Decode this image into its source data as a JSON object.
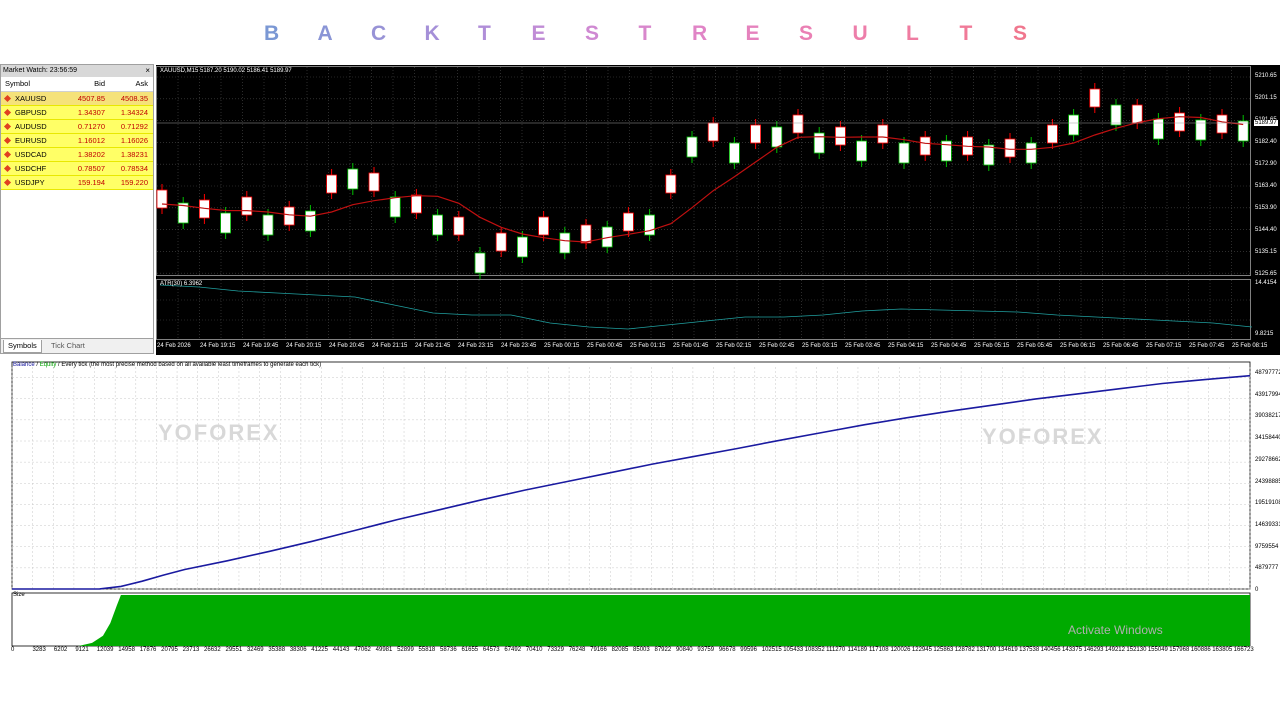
{
  "header": {
    "letters": [
      "B",
      "A",
      "C",
      "K",
      "T",
      "E",
      "S",
      "T",
      "R",
      "E",
      "S",
      "U",
      "L",
      "T",
      "S"
    ],
    "letter_colors": [
      "#7b98d4",
      "#8a95d6",
      "#9893d6",
      "#a590d8",
      "#b08ed8",
      "#c08cd6",
      "#cf89d2",
      "#d887cc",
      "#e084c6",
      "#e582bd",
      "#ea80b4",
      "#ed7eaa",
      "#ef7ca1",
      "#f07a98",
      "#f0778e"
    ]
  },
  "market_watch": {
    "title": "Market Watch: 23:56:59",
    "close": "×",
    "col_symbol": "Symbol",
    "col_bid": "Bid",
    "col_ask": "Ask",
    "rows": [
      {
        "symbol": "XAUUSD",
        "bid": "4507.85",
        "ask": "4508.35"
      },
      {
        "symbol": "GBPUSD",
        "bid": "1.34307",
        "ask": "1.34324"
      },
      {
        "symbol": "AUDUSD",
        "bid": "0.71270",
        "ask": "0.71292"
      },
      {
        "symbol": "EURUSD",
        "bid": "1.16012",
        "ask": "1.16026"
      },
      {
        "symbol": "USDCAD",
        "bid": "1.38202",
        "ask": "1.38231"
      },
      {
        "symbol": "USDCHF",
        "bid": "0.78507",
        "ask": "0.78534"
      },
      {
        "symbol": "USDJPY",
        "bid": "159.194",
        "ask": "159.220"
      }
    ],
    "tab_symbols": "Symbols",
    "tab_tick": "Tick Chart"
  },
  "price_chart": {
    "info": "XAUUSD,M15  5187.20 5190.02 5186.41 5189.97",
    "price_labels": [
      "5210.65",
      "5201.15",
      "5191.65",
      "5182.40",
      "5172.90",
      "5163.40",
      "5153.90",
      "5144.40",
      "5135.15",
      "5125.65"
    ],
    "current_price": "5189.97",
    "atr_label": "ATR(30) 6.3962",
    "atr_labels": [
      "14.4154",
      "9.8215"
    ],
    "time_labels": [
      "24 Feb 2026",
      "24 Feb 19:15",
      "24 Feb 19:45",
      "24 Feb 20:15",
      "24 Feb 20:45",
      "24 Feb 21:15",
      "24 Feb 21:45",
      "24 Feb 23:15",
      "24 Feb 23:45",
      "25 Feb 00:15",
      "25 Feb 00:45",
      "25 Feb 01:15",
      "25 Feb 01:45",
      "25 Feb 02:15",
      "25 Feb 02:45",
      "25 Feb 03:15",
      "25 Feb 03:45",
      "25 Feb 04:15",
      "25 Feb 04:45",
      "25 Feb 05:15",
      "25 Feb 05:45",
      "25 Feb 06:15",
      "25 Feb 06:45",
      "25 Feb 07:15",
      "25 Feb 07:45",
      "25 Feb 08:15"
    ],
    "colors": {
      "bg": "#000000",
      "grid": "#4a4a4a",
      "bull_body": "#ffffff",
      "bull_wick": "#00c000",
      "bear_wick": "#ff0000",
      "ma": "#c01010",
      "atr": "#20a0a0"
    }
  },
  "chart_data": {
    "type": "line",
    "legend_balance": "Balance",
    "legend_sep": " / ",
    "legend_equity": "Equity",
    "legend_rest": " / Every tick (the most precise method based on all available least timeframes to generate each tick)",
    "size_label": "Size",
    "y_labels": [
      "48797772",
      "43917994",
      "39038217",
      "34158440",
      "29278662",
      "24398885",
      "19519108",
      "14639331",
      "9759554",
      "4879777",
      "0"
    ],
    "x_labels": [
      "0",
      "3283",
      "6202",
      "9121",
      "12039",
      "14958",
      "17876",
      "20795",
      "23713",
      "26632",
      "29551",
      "32469",
      "35388",
      "38306",
      "41225",
      "44143",
      "47062",
      "49981",
      "52899",
      "55818",
      "58736",
      "61655",
      "64573",
      "67492",
      "70410",
      "73329",
      "76248",
      "79166",
      "82085",
      "85003",
      "87922",
      "90840",
      "93759",
      "96678",
      "99596",
      "102515",
      "105433",
      "108352",
      "111270",
      "114189",
      "117108",
      "120026",
      "122945",
      "125863",
      "128782",
      "131700",
      "134619",
      "137538",
      "140456",
      "143375",
      "146293",
      "149212",
      "152130",
      "155049",
      "157968",
      "160886",
      "163805",
      "166723"
    ],
    "x_max": 170000,
    "y_max": 51200000,
    "balance": {
      "x": [
        0,
        3283,
        9121,
        12039,
        14958,
        17876,
        20795,
        23713,
        29551,
        35388,
        41225,
        47062,
        52899,
        58736,
        64573,
        70410,
        76248,
        82085,
        87922,
        93759,
        99596,
        105433,
        111270,
        117108,
        122945,
        128782,
        134619,
        140456,
        146293,
        152130,
        157968,
        163805,
        170000
      ],
      "y": [
        0,
        0,
        0,
        30000,
        600000,
        1800000,
        3200000,
        4500000,
        6500000,
        8700000,
        11000000,
        13500000,
        16000000,
        18300000,
        20600000,
        22800000,
        24800000,
        26800000,
        28800000,
        30600000,
        32400000,
        34300000,
        36100000,
        37900000,
        39500000,
        41000000,
        42400000,
        43800000,
        45000000,
        46200000,
        47400000,
        48300000,
        49200000
      ]
    },
    "size": {
      "ramp_x": [
        9121,
        11000,
        12500,
        13500,
        14400,
        14958
      ],
      "ramp_y": [
        0,
        0.06,
        0.2,
        0.45,
        0.8,
        1.0
      ]
    },
    "colors": {
      "balance": "#1a1aa0",
      "equity": "#00a000",
      "size": "#00aa00",
      "grid": "#c8c8c8"
    }
  },
  "watermarks": {
    "brand": "YOFOREX",
    "brand2": "YOFOREX"
  },
  "os_notice": {
    "line1": "Activate Windows"
  }
}
